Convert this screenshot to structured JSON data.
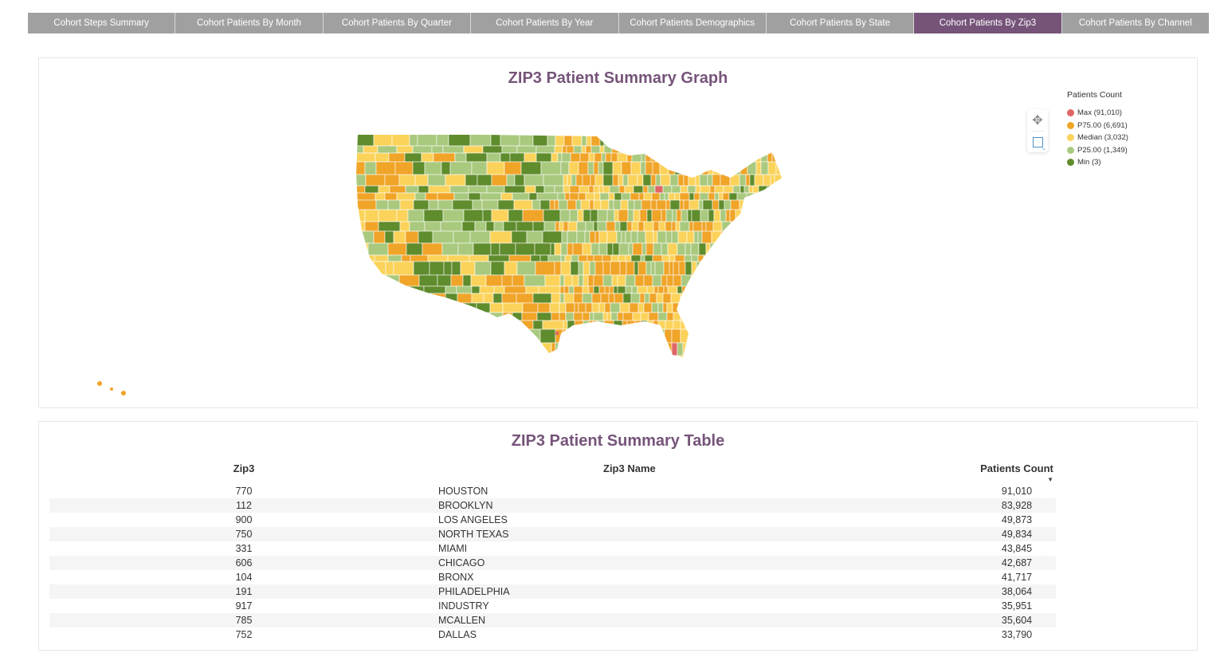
{
  "tabs": [
    {
      "label": "Cohort Steps Summary",
      "active": false
    },
    {
      "label": "Cohort Patients By Month",
      "active": false
    },
    {
      "label": "Cohort Patients By Quarter",
      "active": false
    },
    {
      "label": "Cohort Patients By Year",
      "active": false
    },
    {
      "label": "Cohort Patients Demographics",
      "active": false
    },
    {
      "label": "Cohort Patients By State",
      "active": false
    },
    {
      "label": "Cohort Patients By Zip3",
      "active": true
    },
    {
      "label": "Cohort Patients By Channel",
      "active": false
    }
  ],
  "colors": {
    "accent": "#76547a",
    "tab_inactive": "#a0a0a0",
    "max": "#e06666",
    "p75": "#f0a428",
    "median": "#fbd35a",
    "p25": "#a9c97e",
    "min": "#5f8c2c"
  },
  "graph": {
    "title": "ZIP3 Patient Summary Graph",
    "toolbar": {
      "pan_icon": "move-icon",
      "select_icon": "box-select-icon"
    },
    "legend": {
      "title": "Patients Count",
      "items": [
        {
          "label": "Max (91,010)",
          "color_key": "max"
        },
        {
          "label": "P75.00 (6,691)",
          "color_key": "p75"
        },
        {
          "label": "Median (3,032)",
          "color_key": "median"
        },
        {
          "label": "P25.00 (1,349)",
          "color_key": "p25"
        },
        {
          "label": "Min (3)",
          "color_key": "min"
        }
      ]
    }
  },
  "chart_data": {
    "type": "heatmap",
    "title": "ZIP3 Patient Summary Graph",
    "subtype": "choropleth-us-zip3",
    "legend_title": "Patients Count",
    "legend_placement": "top-right",
    "color_scale": [
      {
        "label": "Max",
        "value": 91010
      },
      {
        "label": "P75.00",
        "value": 6691
      },
      {
        "label": "Median",
        "value": 3032
      },
      {
        "label": "P25.00",
        "value": 1349
      },
      {
        "label": "Min",
        "value": 3
      }
    ]
  },
  "table": {
    "title": "ZIP3 Patient Summary Table",
    "columns": [
      "Zip3",
      "Zip3 Name",
      "Patients Count"
    ],
    "sort": {
      "column": "Patients Count",
      "direction": "descending"
    },
    "rows": [
      {
        "zip3": "770",
        "name": "HOUSTON",
        "count": "91,010"
      },
      {
        "zip3": "112",
        "name": "BROOKLYN",
        "count": "83,928"
      },
      {
        "zip3": "900",
        "name": "LOS ANGELES",
        "count": "49,873"
      },
      {
        "zip3": "750",
        "name": "NORTH TEXAS",
        "count": "49,834"
      },
      {
        "zip3": "331",
        "name": "MIAMI",
        "count": "43,845"
      },
      {
        "zip3": "606",
        "name": "CHICAGO",
        "count": "42,687"
      },
      {
        "zip3": "104",
        "name": "BRONX",
        "count": "41,717"
      },
      {
        "zip3": "191",
        "name": "PHILADELPHIA",
        "count": "38,064"
      },
      {
        "zip3": "917",
        "name": "INDUSTRY",
        "count": "35,951"
      },
      {
        "zip3": "785",
        "name": "MCALLEN",
        "count": "35,604"
      },
      {
        "zip3": "752",
        "name": "DALLAS",
        "count": "33,790"
      }
    ]
  }
}
